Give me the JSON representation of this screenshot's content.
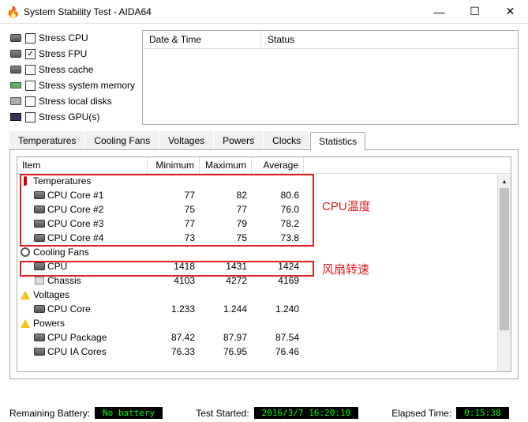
{
  "window": {
    "title": "System Stability Test - AIDA64"
  },
  "stress": {
    "items": [
      {
        "label": "Stress CPU",
        "checked": false,
        "icon": "chip"
      },
      {
        "label": "Stress FPU",
        "checked": true,
        "icon": "chip"
      },
      {
        "label": "Stress cache",
        "checked": false,
        "icon": "chip"
      },
      {
        "label": "Stress system memory",
        "checked": false,
        "icon": "ram"
      },
      {
        "label": "Stress local disks",
        "checked": false,
        "icon": "disk"
      },
      {
        "label": "Stress GPU(s)",
        "checked": false,
        "icon": "gpu"
      }
    ]
  },
  "log": {
    "col1": "Date & Time",
    "col2": "Status"
  },
  "tabs": [
    "Temperatures",
    "Cooling Fans",
    "Voltages",
    "Powers",
    "Clocks",
    "Statistics"
  ],
  "active_tab": 5,
  "stats": {
    "headers": [
      "Item",
      "Minimum",
      "Maximum",
      "Average"
    ],
    "groups": [
      {
        "name": "Temperatures",
        "icon": "therm",
        "rows": [
          {
            "label": "CPU Core #1",
            "min": "77",
            "max": "82",
            "avg": "80.6",
            "icon": "chip"
          },
          {
            "label": "CPU Core #2",
            "min": "75",
            "max": "77",
            "avg": "76.0",
            "icon": "chip"
          },
          {
            "label": "CPU Core #3",
            "min": "77",
            "max": "79",
            "avg": "78.2",
            "icon": "chip"
          },
          {
            "label": "CPU Core #4",
            "min": "73",
            "max": "75",
            "avg": "73.8",
            "icon": "chip"
          }
        ]
      },
      {
        "name": "Cooling Fans",
        "icon": "fan",
        "rows": [
          {
            "label": "CPU",
            "min": "1418",
            "max": "1431",
            "avg": "1424",
            "icon": "chip"
          },
          {
            "label": "Chassis",
            "min": "4103",
            "max": "4272",
            "avg": "4169",
            "icon": "box"
          }
        ]
      },
      {
        "name": "Voltages",
        "icon": "warn",
        "rows": [
          {
            "label": "CPU Core",
            "min": "1.233",
            "max": "1.244",
            "avg": "1.240",
            "icon": "chip"
          }
        ]
      },
      {
        "name": "Powers",
        "icon": "warn",
        "rows": [
          {
            "label": "CPU Package",
            "min": "87.42",
            "max": "87.97",
            "avg": "87.54",
            "icon": "chip"
          },
          {
            "label": "CPU IA Cores",
            "min": "76.33",
            "max": "76.95",
            "avg": "76.46",
            "icon": "chip"
          }
        ]
      }
    ]
  },
  "annotations": {
    "temp": "CPU温度",
    "fan": "风扇转速"
  },
  "statusbar": {
    "battery_label": "Remaining Battery:",
    "battery_value": "No battery",
    "started_label": "Test Started:",
    "started_value": "2016/3/7 16:20:10",
    "elapsed_label": "Elapsed Time:",
    "elapsed_value": "0:15:38"
  }
}
